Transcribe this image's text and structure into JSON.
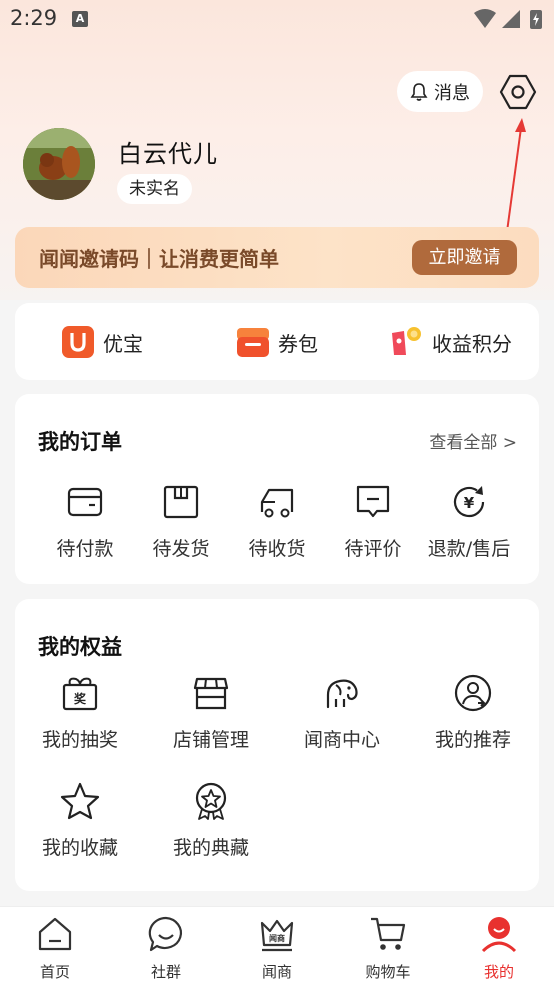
{
  "status_bar": {
    "time": "2:29",
    "notification_icon": "A"
  },
  "header": {
    "messages_label": "消息"
  },
  "profile": {
    "name": "白云代儿",
    "verify_status": "未实名"
  },
  "invite": {
    "text": "闻闻邀请码｜让消费更简单",
    "button": "立即邀请"
  },
  "wallet": {
    "items": [
      {
        "label": "优宝",
        "icon": "u-badge-icon"
      },
      {
        "label": "券包",
        "icon": "coupon-icon"
      },
      {
        "label": "收益积分",
        "icon": "points-icon"
      }
    ]
  },
  "orders": {
    "title": "我的订单",
    "see_all": "查看全部 >",
    "items": [
      {
        "label": "待付款",
        "icon": "wallet-icon"
      },
      {
        "label": "待发货",
        "icon": "box-icon"
      },
      {
        "label": "待收货",
        "icon": "truck-icon"
      },
      {
        "label": "待评价",
        "icon": "comment-icon"
      },
      {
        "label": "退款/售后",
        "icon": "refund-icon"
      }
    ]
  },
  "benefits": {
    "title": "我的权益",
    "items": [
      {
        "label": "我的抽奖",
        "icon": "lottery-icon",
        "icon_text": "奖"
      },
      {
        "label": "店铺管理",
        "icon": "store-icon"
      },
      {
        "label": "闻商中心",
        "icon": "elephant-icon"
      },
      {
        "label": "我的推荐",
        "icon": "recommend-user-icon"
      },
      {
        "label": "我的收藏",
        "icon": "star-icon"
      },
      {
        "label": "我的典藏",
        "icon": "medal-icon"
      }
    ]
  },
  "bottom_nav": {
    "items": [
      {
        "label": "首页",
        "icon": "home-icon"
      },
      {
        "label": "社群",
        "icon": "chat-icon"
      },
      {
        "label": "闻商",
        "icon": "crown-icon",
        "icon_text": "闻商"
      },
      {
        "label": "购物车",
        "icon": "cart-icon"
      },
      {
        "label": "我的",
        "icon": "profile-icon",
        "active": true
      }
    ]
  },
  "colors": {
    "accent": "#e8312f",
    "invite_button": "#b06a3c",
    "invite_text": "#7a4a2a"
  }
}
